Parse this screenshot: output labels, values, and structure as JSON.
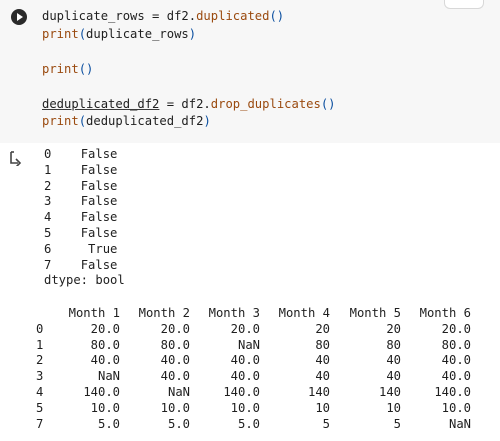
{
  "code_lines": [
    {
      "a": "duplicate_rows = df2.",
      "fn": "duplicated",
      "p": "()"
    },
    {
      "a": "print",
      "p1": "(",
      "b": "duplicate_rows",
      "p2": ")"
    },
    {
      "a": "print",
      "p": "()"
    },
    {
      "und": "deduplicated_df2",
      "a": " = df2.",
      "fn": "drop_duplicates",
      "p": "()"
    },
    {
      "a": "print",
      "p1": "(",
      "b": "deduplicated_df2",
      "p2": ")"
    }
  ],
  "series_output": [
    {
      "idx": "0",
      "val": "False"
    },
    {
      "idx": "1",
      "val": "False"
    },
    {
      "idx": "2",
      "val": "False"
    },
    {
      "idx": "3",
      "val": "False"
    },
    {
      "idx": "4",
      "val": "False"
    },
    {
      "idx": "5",
      "val": "False"
    },
    {
      "idx": "6",
      "val": "True"
    },
    {
      "idx": "7",
      "val": "False"
    }
  ],
  "dtype_line": "dtype: bool",
  "table": {
    "columns": [
      "Month 1",
      "Month 2",
      "Month 3",
      "Month 4",
      "Month 5",
      "Month 6"
    ],
    "rows": [
      {
        "idx": "0",
        "cells": [
          "20.0",
          "20.0",
          "20.0",
          "20",
          "20",
          "20.0"
        ]
      },
      {
        "idx": "1",
        "cells": [
          "80.0",
          "80.0",
          "NaN",
          "80",
          "80",
          "80.0"
        ]
      },
      {
        "idx": "2",
        "cells": [
          "40.0",
          "40.0",
          "40.0",
          "40",
          "40",
          "40.0"
        ]
      },
      {
        "idx": "3",
        "cells": [
          "NaN",
          "40.0",
          "40.0",
          "40",
          "40",
          "40.0"
        ]
      },
      {
        "idx": "4",
        "cells": [
          "140.0",
          "NaN",
          "140.0",
          "140",
          "140",
          "140.0"
        ]
      },
      {
        "idx": "5",
        "cells": [
          "10.0",
          "10.0",
          "10.0",
          "10",
          "10",
          "10.0"
        ]
      },
      {
        "idx": "7",
        "cells": [
          "5.0",
          "5.0",
          "5.0",
          "5",
          "5",
          "NaN"
        ]
      }
    ]
  },
  "icons": {
    "run": "play-circle-icon",
    "output": "output-arrow-icon"
  }
}
